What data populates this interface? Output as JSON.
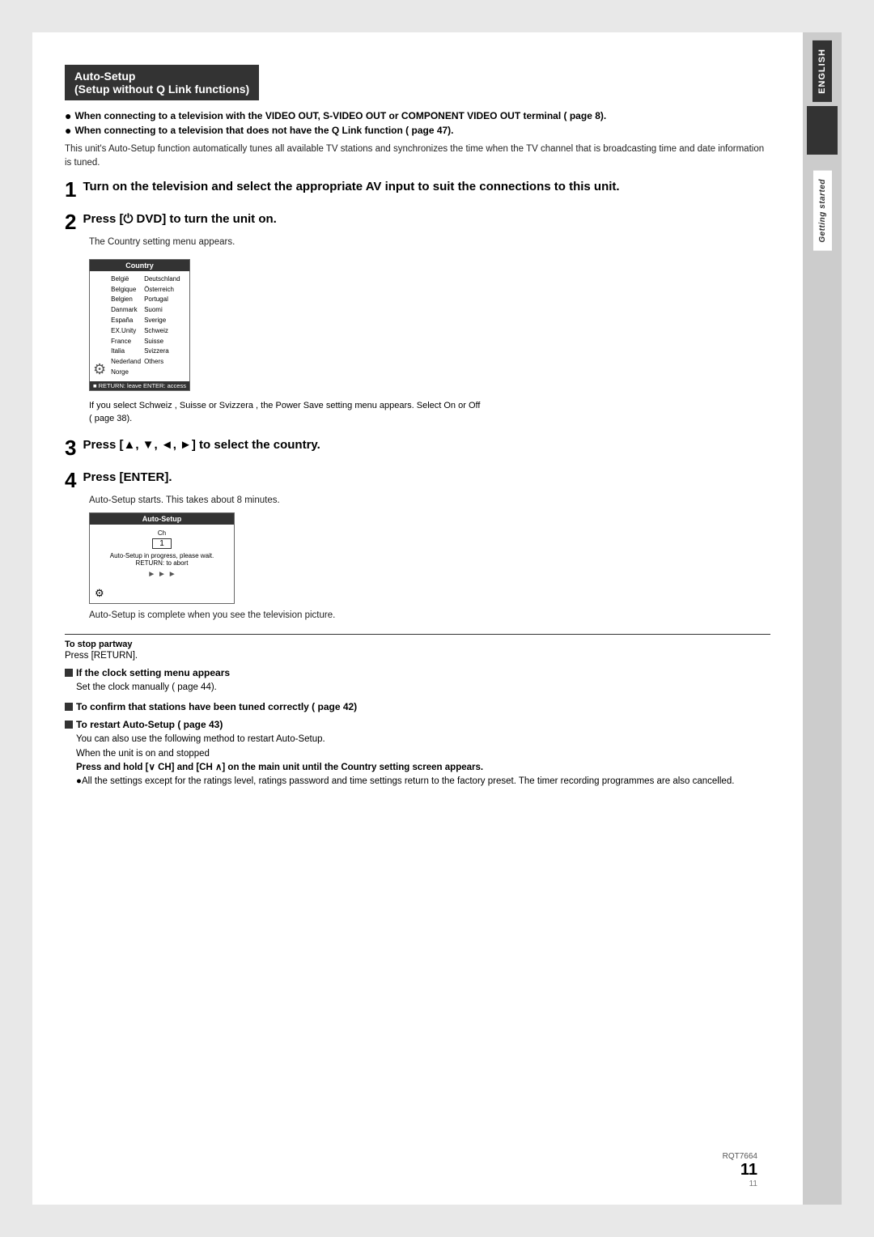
{
  "page": {
    "page_number": "11",
    "rqt_code": "RQT7664",
    "page_small": "11"
  },
  "sidebar": {
    "english_label": "ENGLISH",
    "getting_started_label": "Getting started"
  },
  "title": {
    "main": "Auto-Setup",
    "sub": "(Setup without Q Link functions)"
  },
  "bullets": [
    {
      "text": "When connecting to a television with the VIDEO OUT, S-VIDEO OUT or COMPONENT VIDEO OUT terminal (  page 8)."
    },
    {
      "text": "When connecting to a television that does not have the Q Link function (  page 47)."
    }
  ],
  "description": "This unit's Auto-Setup function automatically tunes all available TV stations and synchronizes the time when the TV channel that is broadcasting time and date information is tuned.",
  "steps": [
    {
      "number": "1",
      "text": "Turn on the television and select the appropriate AV input to suit the connections to this unit."
    },
    {
      "number": "2",
      "text": "Press [⏻ DVD] to turn the unit on.",
      "sub_text": "The Country setting menu appears.",
      "has_screen": true,
      "screen_note": "If you select Schweiz , Suisse or Svizzera , the Power Save  setting menu appears. Select On or Off  (  page 38)."
    },
    {
      "number": "3",
      "text": "Press [▲, ▼, ◄, ►] to select the country."
    },
    {
      "number": "4",
      "text": "Press [ENTER].",
      "sub_text": "Auto-Setup starts. This takes about 8 minutes.",
      "has_autosetup_screen": true,
      "complete_text": "Auto-Setup is complete when you see the television picture."
    }
  ],
  "country_screen": {
    "title": "Country",
    "countries_col1": [
      "België",
      "Belgique",
      "Belgien",
      "Danmark",
      "España",
      "EX.Unity",
      "France",
      "Italia",
      "Nederland",
      "Norge"
    ],
    "countries_col2": [
      "Deutschland",
      "Österreich",
      "Portugal",
      "Suomi",
      "Sverige",
      "Schweiz",
      "Suisse",
      "Svizzera",
      "Others"
    ],
    "footer": "■  RETURN: leave  ENTER: access"
  },
  "autosetup_screen": {
    "title": "Auto-Setup",
    "ch_label": "Ch",
    "ch_number": "1",
    "message": "Auto-Setup in progress, please wait.",
    "return_text": "RETURN: to abort",
    "arrows": "► ► ►"
  },
  "sections": {
    "stop": {
      "label": "To stop partway",
      "text": "Press [RETURN]."
    },
    "clock": {
      "title": "If the clock setting menu appears",
      "body": "Set the clock manually (  page 44)."
    },
    "confirm": {
      "title": "To confirm that stations have been tuned correctly (  page 42)"
    },
    "restart": {
      "title": "To restart Auto-Setup (  page 43)",
      "intro": "You can also use the following method to restart Auto-Setup.",
      "when": "When the unit is on and stopped",
      "bold_text": "Press and hold [∨ CH] and [CH ∧] on the main unit until the Country setting screen appears.",
      "bullet": "All the settings except for the ratings level, ratings password and time settings return to the factory preset. The timer recording programmes are also cancelled."
    }
  }
}
